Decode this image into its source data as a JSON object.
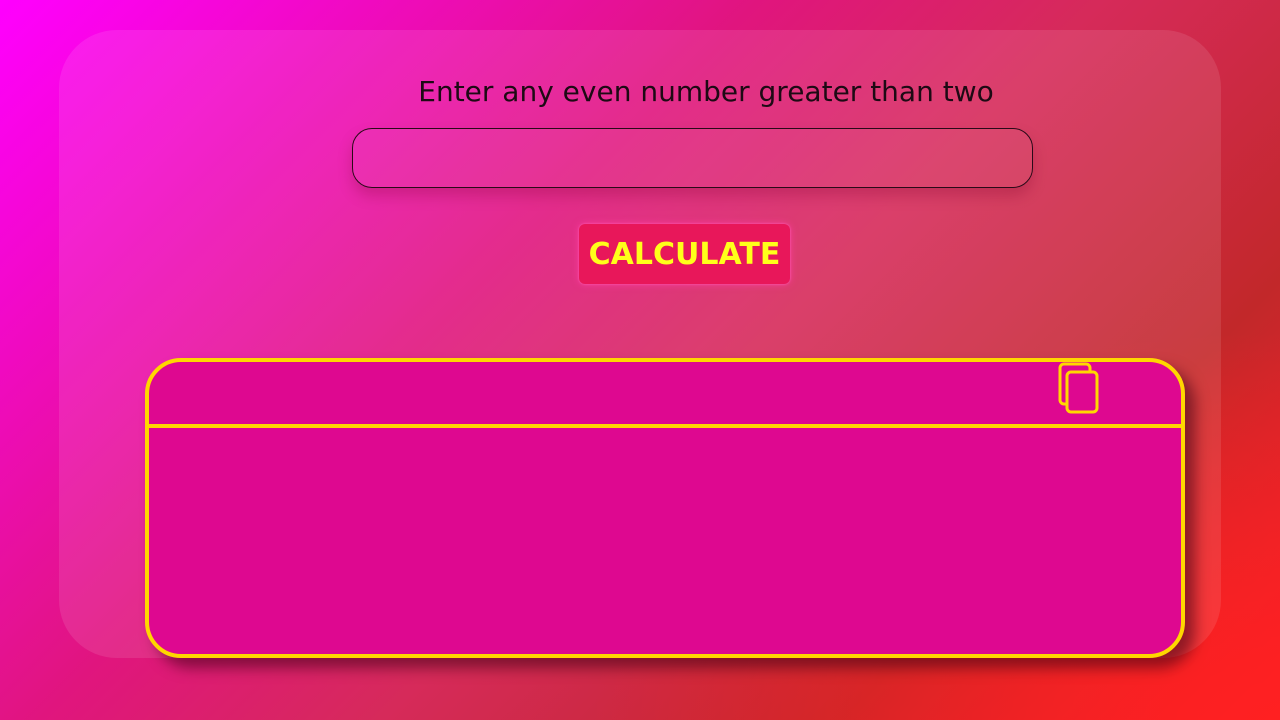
{
  "form": {
    "prompt": "Enter any even number greater than two",
    "input_value": "",
    "input_placeholder": "",
    "calculate_label": "CALCULATE"
  },
  "result": {
    "header_text": "",
    "body_text": "",
    "copy_icon": "copy-icon"
  },
  "colors": {
    "accent_yellow": "#ffd700",
    "button_text": "#ffff1a",
    "button_bg": "#e8175a",
    "result_bg": "#de0890"
  }
}
